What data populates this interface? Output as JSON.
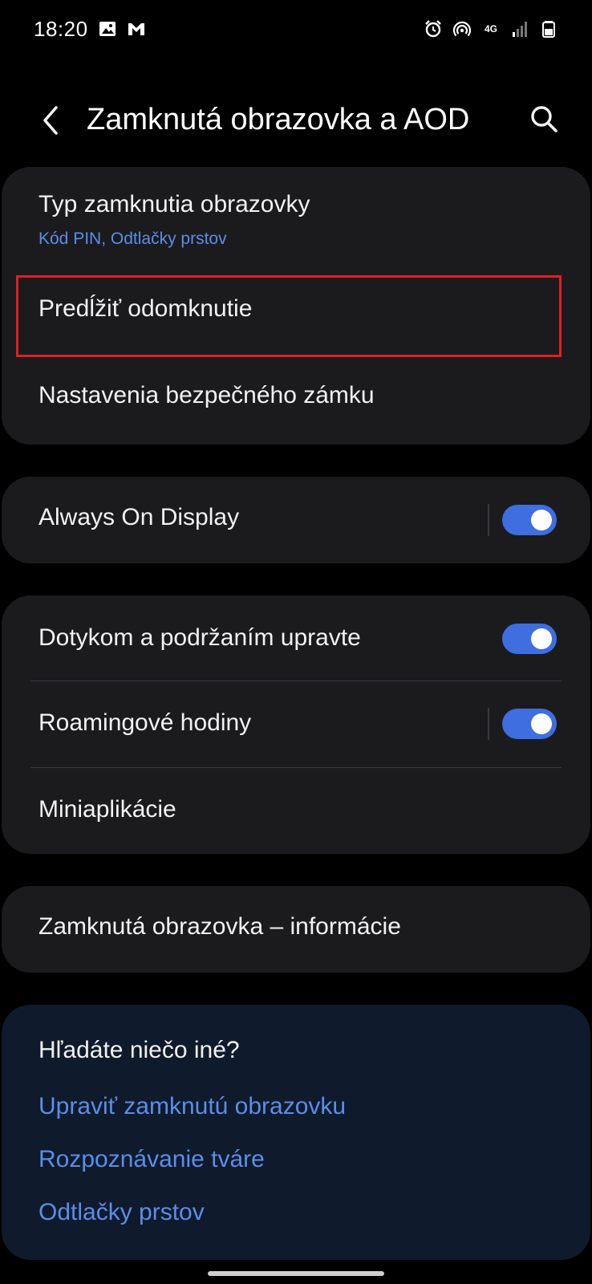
{
  "status_bar": {
    "time": "18:20",
    "network_label_top": "4G",
    "icons": [
      "image-icon",
      "mail-icon",
      "alarm-icon",
      "hotspot-icon",
      "network-4g-icon",
      "signal-icon",
      "battery-icon"
    ]
  },
  "header": {
    "title": "Zamknutá obrazovka a AOD",
    "back_icon": "chevron-left-icon",
    "search_icon": "search-icon"
  },
  "card_security": {
    "lock_type": {
      "title": "Typ zamknutia obrazovky",
      "subtitle": "Kód PIN, Odtlačky prstov"
    },
    "extend_unlock": {
      "title": "Predĺžiť odomknutie"
    },
    "secure_lock_settings": {
      "title": "Nastavenia bezpečného zámku"
    }
  },
  "card_aod": {
    "always_on_display": {
      "title": "Always On Display",
      "enabled": true
    }
  },
  "card_lockscreen": {
    "touch_hold_edit": {
      "title": "Dotykom a podržaním upravte",
      "enabled": true
    },
    "roaming_clock": {
      "title": "Roamingové hodiny",
      "enabled": true
    },
    "widgets": {
      "title": "Miniaplikácie"
    }
  },
  "card_about": {
    "about_lock_screen": {
      "title": "Zamknutá obrazovka – informácie"
    }
  },
  "suggestions": {
    "title": "Hľadáte niečo iné?",
    "links": [
      "Upraviť zamknutú obrazovku",
      "Rozpoznávanie tváre",
      "Odtlačky prstov"
    ]
  },
  "colors": {
    "background": "#000000",
    "card": "#1b1b1e",
    "suggest_card": "#0f1a2c",
    "accent": "#5a8ee8",
    "toggle_on": "#3e6ee0",
    "highlight": "#e02020"
  }
}
